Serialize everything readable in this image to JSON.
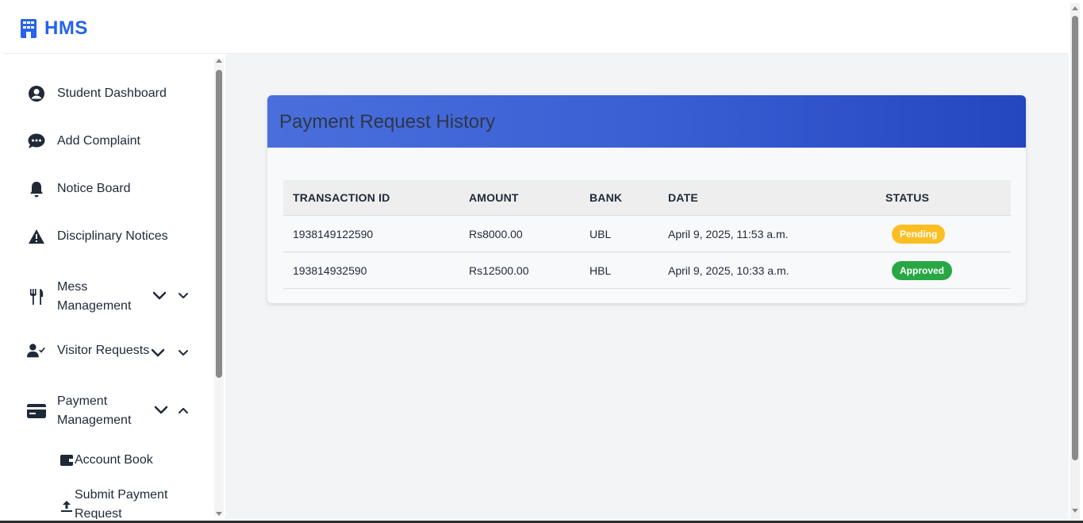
{
  "app": {
    "brand": "HMS"
  },
  "sidebar": {
    "items": [
      {
        "label": "Student Dashboard",
        "icon": "user-circle-icon"
      },
      {
        "label": "Add Complaint",
        "icon": "chat-bubble-icon"
      },
      {
        "label": "Notice Board",
        "icon": "bell-icon"
      },
      {
        "label": "Disciplinary Notices",
        "icon": "warning-icon"
      },
      {
        "label": "Mess Management",
        "icon": "utensils-icon"
      },
      {
        "label": "Visitor Requests",
        "icon": "user-check-icon"
      },
      {
        "label": "Payment Management",
        "icon": "credit-card-icon"
      }
    ],
    "subitems": [
      {
        "label": "Account Book",
        "icon": "wallet-icon"
      },
      {
        "label": "Submit Payment Request",
        "icon": "upload-icon"
      }
    ]
  },
  "card": {
    "title": "Payment Request History",
    "columns": [
      "TRANSACTION ID",
      "AMOUNT",
      "BANK",
      "DATE",
      "STATUS"
    ],
    "rows": [
      {
        "id": "1938149122590",
        "amount": "Rs8000.00",
        "bank": "UBL",
        "date": "April 9, 2025, 11:53 a.m.",
        "status": "Pending"
      },
      {
        "id": "193814932590",
        "amount": "Rs12500.00",
        "bank": "HBL",
        "date": "April 9, 2025, 10:33 a.m.",
        "status": "Approved"
      }
    ]
  },
  "colors": {
    "brand": "#2563eb",
    "header_gradient_start": "#4a6fdc",
    "header_gradient_end": "#2446c0",
    "pending": "#fbbf24",
    "approved": "#28a745"
  }
}
